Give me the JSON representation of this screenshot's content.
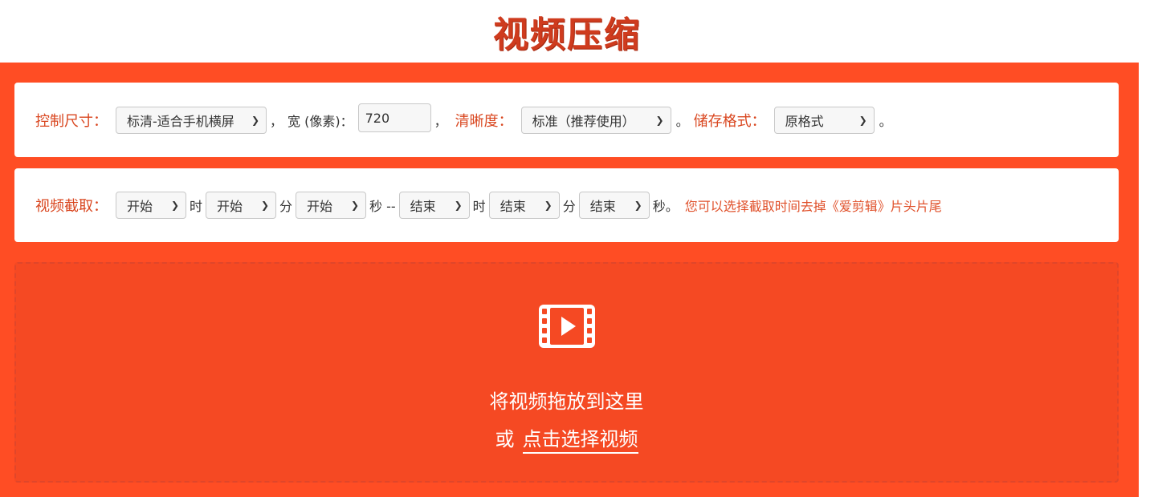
{
  "header": {
    "title": "视频压缩"
  },
  "size_card": {
    "size_label": "控制尺寸：",
    "size_select": "标清-适合手机横屏",
    "sep1": "，",
    "width_label": "宽 (像素)：",
    "width_value": "720",
    "sep2": "，",
    "clarity_label": "清晰度：",
    "clarity_select": "标准（推荐使用）",
    "sep3": "。",
    "format_label": "储存格式：",
    "format_select": "原格式",
    "sep4": "。"
  },
  "trim_card": {
    "trim_label": "视频截取：",
    "start_hour": "开始",
    "unit_hour": "时",
    "start_minute": "开始",
    "unit_minute": "分",
    "start_second": "开始",
    "unit_second_range": "秒 --",
    "end_hour": "结束",
    "unit_hour2": "时",
    "end_minute": "结束",
    "unit_minute2": "分",
    "end_second": "结束",
    "unit_second_end": "秒。",
    "hint": "您可以选择截取时间去掉《爱剪辑》片头片尾"
  },
  "dropzone": {
    "icon": "film-icon",
    "drop_text": "将视频拖放到这里",
    "or_text": "或",
    "choose_link": "点击选择视频"
  },
  "colors": {
    "accent": "#ff4d24",
    "title": "#cf3b1e",
    "label": "#d9461f"
  }
}
